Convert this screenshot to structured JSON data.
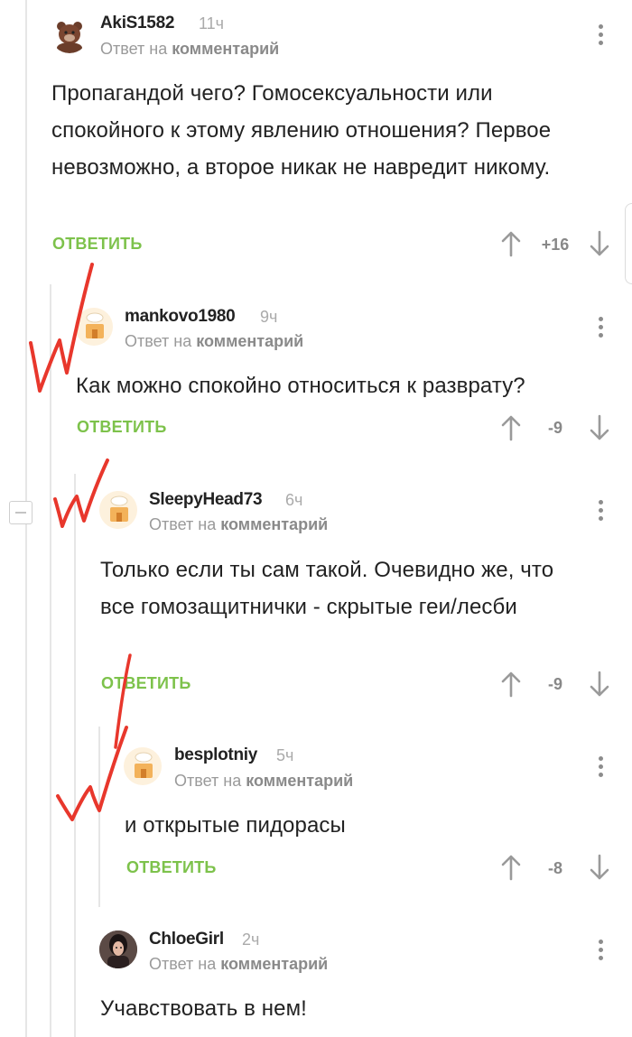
{
  "reply_label": "ОТВЕТИТЬ",
  "reply_to_prefix": "Ответ на",
  "reply_to_target": "комментарий",
  "comments": [
    {
      "author": "AkiS1582",
      "time": "11ч",
      "avatar": "bear-avatar",
      "text": "Пропагандой чего? Гомосексуальности или спокойного к этому явлению отношения? Первое невозможно, а второе никак не навредит никому.",
      "score": "+16"
    },
    {
      "author": "mankovo1980",
      "time": "9ч",
      "avatar": "default-house-avatar",
      "text": "Как можно спокойно относиться к разврату?",
      "score": "-9"
    },
    {
      "author": "SleepyHead73",
      "time": "6ч",
      "avatar": "default-house-avatar",
      "text": "Только если ты сам такой. Очевидно же, что все гомозащитнички - скрытые геи/лесби",
      "score": "-9"
    },
    {
      "author": "besplotniy",
      "time": "5ч",
      "avatar": "default-house-avatar",
      "text": "и открытые пидорасы",
      "score": "-8"
    },
    {
      "author": "ChloeGirl",
      "time": "2ч",
      "avatar": "girl-photo-avatar",
      "text": "Учавствовать в нем!",
      "score": ""
    }
  ],
  "colors": {
    "accent_green": "#7dc24b",
    "annotation_red": "#e8372c",
    "thread_line": "#e6e6e6"
  }
}
